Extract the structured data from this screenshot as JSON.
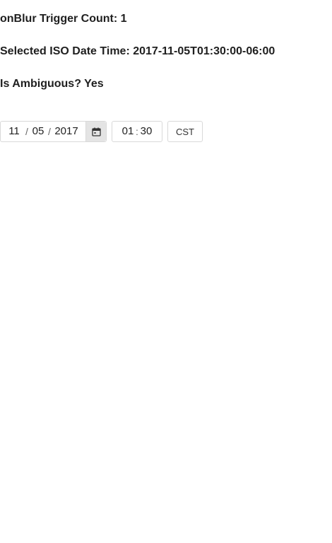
{
  "status": {
    "blur_count": "onBlur Trigger Count: 1",
    "iso_datetime": "Selected ISO Date Time: 2017-11-05T01:30:00-06:00",
    "ambiguous": "Is Ambiguous? Yes"
  },
  "date_picker": {
    "month": "11",
    "day": "05",
    "year": "2017",
    "separator": "/",
    "icon": "calendar-icon"
  },
  "time_picker": {
    "hour": "01",
    "minute": "30",
    "separator": ":"
  },
  "timezone": {
    "label": "CST"
  }
}
